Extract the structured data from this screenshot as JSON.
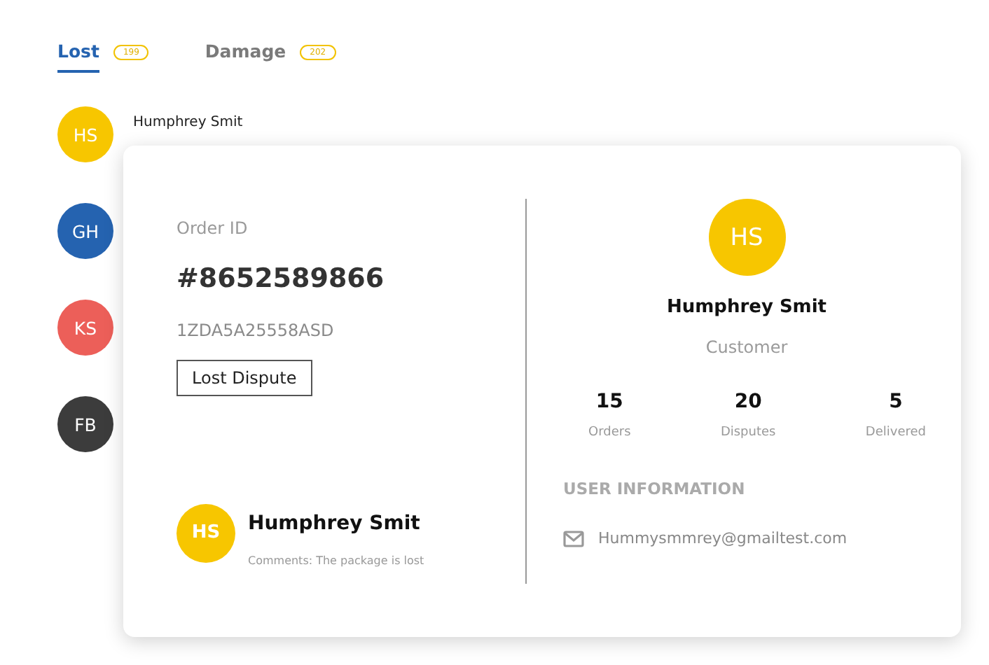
{
  "tabs": [
    {
      "label": "Lost",
      "count": "199",
      "selected": true
    },
    {
      "label": "Damage",
      "count": "202",
      "selected": false
    }
  ],
  "contacts": [
    {
      "initials": "HS",
      "name": "Humphrey Smit",
      "color": "#f7c600"
    },
    {
      "initials": "GH",
      "color": "#2563b0"
    },
    {
      "initials": "KS",
      "color": "#ec5f59"
    },
    {
      "initials": "FB",
      "color": "#3c3c3c"
    }
  ],
  "detail": {
    "order_label": "Order ID",
    "order_id": "#8652589866",
    "tracking": "1ZDA5A25558ASD",
    "status": "Lost Dispute",
    "comment": {
      "initials": "HS",
      "color": "#f7c600",
      "name": "Humphrey Smit",
      "text": "Comments: The package is lost"
    },
    "customer": {
      "initials": "HS",
      "color": "#f7c600",
      "name": "Humphrey Smit",
      "role": "Customer",
      "stats": [
        {
          "value": "15",
          "label": "Orders"
        },
        {
          "value": "20",
          "label": "Disputes"
        },
        {
          "value": "5",
          "label": "Delivered"
        }
      ],
      "info_heading": "USER INFORMATION",
      "email": "Hummysmmrey@gmailtest.com"
    }
  }
}
